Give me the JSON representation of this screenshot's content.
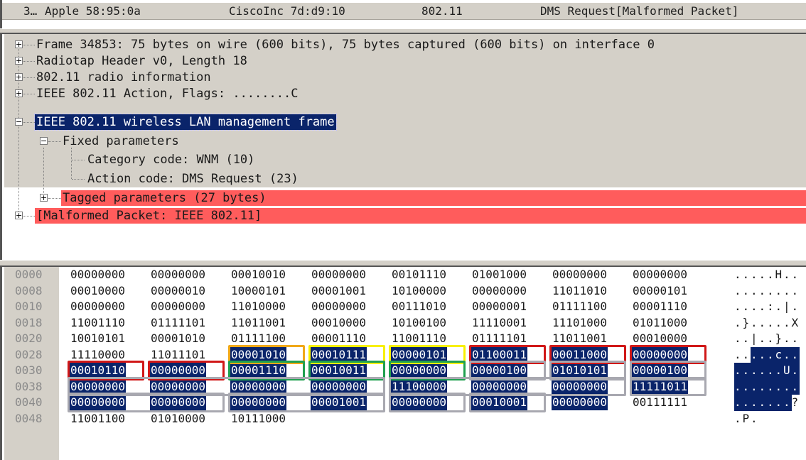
{
  "packet_list": {
    "selected_row": {
      "no": "3…",
      "source": "Apple 58:95:0a",
      "destination": "CiscoInc 7d:d9:10",
      "protocol": "802.11",
      "info": "DMS Request[Malformed Packet]"
    }
  },
  "detail_tree": {
    "items": [
      {
        "label": "Frame 34853: 75 bytes on wire (600 bits), 75 bytes captured (600 bits) on interface 0",
        "expander": "+",
        "state": "normal"
      },
      {
        "label": "Radiotap Header v0, Length 18",
        "expander": "+",
        "state": "normal"
      },
      {
        "label": "802.11 radio information",
        "expander": "+",
        "state": "normal"
      },
      {
        "label": "IEEE 802.11 Action, Flags: ........C",
        "expander": "+",
        "state": "normal"
      },
      {
        "label": "IEEE 802.11 wireless LAN management frame",
        "expander": "−",
        "state": "selected"
      },
      {
        "label": "Fixed parameters",
        "expander": "−",
        "state": "normal"
      },
      {
        "label": "Category code: WNM (10)",
        "expander": "",
        "state": "normal"
      },
      {
        "label": "Action code: DMS Request (23)",
        "expander": "",
        "state": "normal"
      },
      {
        "label": "Tagged parameters (27 bytes)",
        "expander": "+",
        "state": "error"
      },
      {
        "label": "[Malformed Packet: IEEE 802.11]",
        "expander": "+",
        "state": "error"
      }
    ]
  },
  "bytes_pane": {
    "rows": [
      {
        "offset": "0000",
        "bytes": [
          "00000000",
          "00000000",
          "00010010",
          "00000000",
          "00101110",
          "01001000",
          "00000000",
          "00000000"
        ],
        "ascii": ".....H.."
      },
      {
        "offset": "0008",
        "bytes": [
          "00010000",
          "00000010",
          "10000101",
          "00001001",
          "10100000",
          "00000000",
          "11011010",
          "00000101"
        ],
        "ascii": "........"
      },
      {
        "offset": "0010",
        "bytes": [
          "00000000",
          "00000000",
          "11010000",
          "00000000",
          "00111010",
          "00000001",
          "01111100",
          "00001110"
        ],
        "ascii": "....:.|."
      },
      {
        "offset": "0018",
        "bytes": [
          "11001110",
          "01111101",
          "11011001",
          "00010000",
          "10100100",
          "11110001",
          "11101000",
          "01011000"
        ],
        "ascii": ".}.....X"
      },
      {
        "offset": "0020",
        "bytes": [
          "10010101",
          "00001010",
          "01111100",
          "00001110",
          "11001110",
          "01111101",
          "11011001",
          "00010000"
        ],
        "ascii": "..|..}.."
      },
      {
        "offset": "0028",
        "bytes": [
          "11110000",
          "11011101",
          "00001010",
          "00010111",
          "00000101",
          "01100011",
          "00011000",
          "00000000"
        ],
        "ascii": ".....c.."
      },
      {
        "offset": "0030",
        "bytes": [
          "00010110",
          "00000000",
          "00001110",
          "00010011",
          "00000000",
          "00000100",
          "01010101",
          "00000100"
        ],
        "ascii": "......U."
      },
      {
        "offset": "0038",
        "bytes": [
          "00000000",
          "00000000",
          "00000000",
          "00000000",
          "11100000",
          "00000000",
          "00000000",
          "11111011"
        ],
        "ascii": "........"
      },
      {
        "offset": "0040",
        "bytes": [
          "00000000",
          "00000000",
          "00000000",
          "00001001",
          "00000000",
          "00010001",
          "00000000",
          "00111111"
        ],
        "ascii": ".......?"
      },
      {
        "offset": "0048",
        "bytes": [
          "11001100",
          "01010000",
          "10111000"
        ],
        "ascii": ".P."
      }
    ],
    "highlight_color": "#0a246a",
    "annotation_colors": {
      "orange": "#f0a818",
      "yellow": "#f8f000",
      "red": "#d01818",
      "green": "#20a050",
      "gray": "#a8a8b0"
    }
  }
}
